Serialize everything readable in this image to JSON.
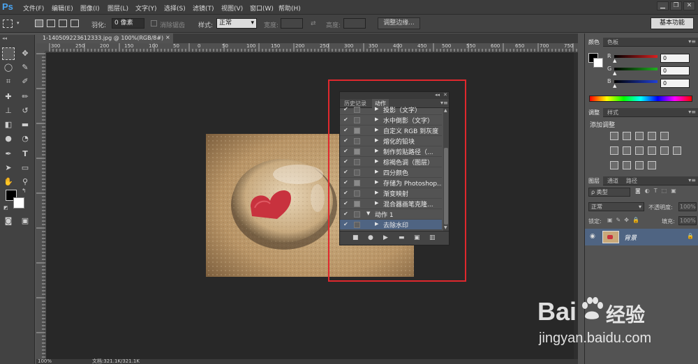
{
  "app": {
    "logo": "Ps"
  },
  "menu": {
    "items": [
      "文件(F)",
      "编辑(E)",
      "图像(I)",
      "图层(L)",
      "文字(Y)",
      "选择(S)",
      "滤镜(T)",
      "视图(V)",
      "窗口(W)",
      "帮助(H)"
    ]
  },
  "window_controls": {
    "minimize": "▁",
    "restore": "❐",
    "close": "✕"
  },
  "options": {
    "feather_label": "羽化:",
    "feather_value": "0 像素",
    "antialias_label": "消除锯齿",
    "style_label": "样式:",
    "style_value": "正常",
    "width_label": "宽度:",
    "height_label": "高度:",
    "refine_edge_button": "调整边缘...",
    "workspace_button": "基本功能"
  },
  "document": {
    "tab_title": "1-140509223612333.jpg @ 100%(RGB/8#)",
    "tab_close": "×"
  },
  "ruler": {
    "h_ticks": [
      "300",
      "250",
      "200",
      "150",
      "100",
      "50",
      "0",
      "50",
      "100",
      "150",
      "200",
      "250",
      "300",
      "350",
      "400",
      "450",
      "500",
      "550",
      "600",
      "650",
      "700",
      "750"
    ]
  },
  "status": {
    "zoom": "100%",
    "doc_info": "文档:321.1K/321.1K"
  },
  "actions_panel": {
    "tabs": [
      {
        "label": "历史记录",
        "active": false
      },
      {
        "label": "动作",
        "active": true
      }
    ],
    "rows": [
      {
        "checked": true,
        "dialog": false,
        "expanded": false,
        "indent": 1,
        "label": "投影（文字）",
        "selected": false
      },
      {
        "checked": true,
        "dialog": false,
        "expanded": false,
        "indent": 1,
        "label": "水中倒影（文字）",
        "selected": false
      },
      {
        "checked": true,
        "dialog": true,
        "expanded": false,
        "indent": 1,
        "label": "自定义 RGB 到灰度",
        "selected": false
      },
      {
        "checked": true,
        "dialog": false,
        "expanded": false,
        "indent": 1,
        "label": "熔化的铅块",
        "selected": false
      },
      {
        "checked": true,
        "dialog": true,
        "expanded": false,
        "indent": 1,
        "label": "制作剪贴路径（...",
        "selected": false
      },
      {
        "checked": true,
        "dialog": false,
        "expanded": false,
        "indent": 1,
        "label": "棕褐色调（图层）",
        "selected": false
      },
      {
        "checked": true,
        "dialog": false,
        "expanded": false,
        "indent": 1,
        "label": "四分颜色",
        "selected": false
      },
      {
        "checked": true,
        "dialog": true,
        "expanded": false,
        "indent": 1,
        "label": "存储为 Photoshop...",
        "selected": false
      },
      {
        "checked": true,
        "dialog": false,
        "expanded": false,
        "indent": 1,
        "label": "渐变映射",
        "selected": false
      },
      {
        "checked": true,
        "dialog": true,
        "expanded": false,
        "indent": 1,
        "label": "混合器画笔克隆...",
        "selected": false
      },
      {
        "checked": true,
        "dialog": false,
        "expanded": true,
        "indent": 0,
        "label": "动作 1",
        "selected": false
      },
      {
        "checked": true,
        "dialog": false,
        "expanded": false,
        "indent": 1,
        "label": "去除水印",
        "selected": true
      }
    ],
    "bottom_buttons": [
      "■",
      "●",
      "▶",
      "▬",
      "▣",
      "▥"
    ]
  },
  "color_panel": {
    "tabs": [
      {
        "label": "颜色",
        "active": true
      },
      {
        "label": "色板",
        "active": false
      }
    ],
    "channels": [
      {
        "name": "R",
        "value": "0",
        "color": "#d82020"
      },
      {
        "name": "G",
        "value": "0",
        "color": "#20b020"
      },
      {
        "name": "B",
        "value": "0",
        "color": "#2040d8"
      }
    ]
  },
  "adjustments_panel": {
    "tabs": [
      {
        "label": "调整",
        "active": true
      },
      {
        "label": "样式",
        "active": false
      }
    ],
    "title": "添加调整"
  },
  "layers_panel": {
    "tabs": [
      {
        "label": "图层",
        "active": true
      },
      {
        "label": "通道",
        "active": false
      },
      {
        "label": "路径",
        "active": false
      }
    ],
    "filter_label": "ρ 类型",
    "blend_mode": "正常",
    "opacity_label": "不透明度:",
    "opacity_value": "100%",
    "lock_label": "锁定:",
    "fill_label": "填充:",
    "fill_value": "100%",
    "layers": [
      {
        "name": "背景",
        "visible": true,
        "locked": true
      }
    ]
  },
  "watermark": {
    "brand": "Bai",
    "brand2": "经验",
    "url": "jingyan.baidu.com"
  },
  "colors": {
    "accent_red": "#e0282d",
    "selection": "#4f6482",
    "bg_dark": "#282828"
  }
}
